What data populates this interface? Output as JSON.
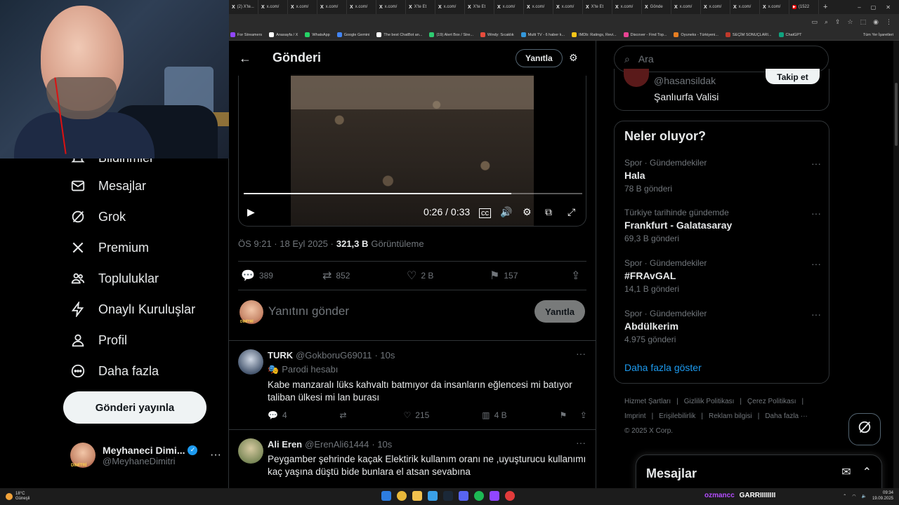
{
  "browser": {
    "tabs": [
      "(2) X'te...",
      "x.com/",
      "x.com/",
      "x.com/",
      "x.com/",
      "x.com/",
      "X'te Et",
      "x.com/",
      "X'te Et",
      "x.com/",
      "x.com/",
      "x.com/",
      "X'te Et",
      "x.com/",
      "Gönde",
      "x.com/",
      "x.com/",
      "x.com/",
      "x.com/",
      "(1522"
    ],
    "bookmarks": [
      "For Streamers",
      "Anasayfa / X",
      "WhatsApp",
      "Google Gemini",
      "The best ChatBot an...",
      "(19) Alert Box / Stre...",
      "Windy: Sıcaklık",
      "Multi TV - 6 haber k...",
      "IMDb: Ratings, Revi...",
      "Discover - Find Top...",
      "Oyuneks - Türkiyeni...",
      "SEÇİM SONUÇLARI...",
      "ChatGPT"
    ],
    "all_bookmarks": "Tüm Yer İşaretleri"
  },
  "sidebar": {
    "items": [
      {
        "label": "Bildirimler",
        "icon": "bell-icon"
      },
      {
        "label": "Mesajlar",
        "icon": "mail-icon"
      },
      {
        "label": "Grok",
        "icon": "grok-icon"
      },
      {
        "label": "Premium",
        "icon": "x-logo-icon"
      },
      {
        "label": "Topluluklar",
        "icon": "people-icon"
      },
      {
        "label": "Onaylı Kuruluşlar",
        "icon": "lightning-icon"
      },
      {
        "label": "Profil",
        "icon": "person-icon"
      },
      {
        "label": "Daha fazla",
        "icon": "more-circle-icon"
      }
    ],
    "post_button": "Gönderi yayınla",
    "account": {
      "name": "Meyhaneci Dimi...",
      "handle": "@MeyhaneDimitri",
      "avatar_text": "DİMİTRİ"
    }
  },
  "main": {
    "title": "Gönderi",
    "reply_pill": "Yanıtla",
    "video": {
      "current": "0:26",
      "duration": "0:33",
      "progress": 0.79
    },
    "meta": {
      "time": "ÖS 9:21 · 18 Eyl 2025 ·",
      "views": "321,3 B",
      "views_label": "Görüntüleme"
    },
    "stats": {
      "replies": "389",
      "reposts": "852",
      "likes": "2 B",
      "bookmarks": "157"
    },
    "compose": {
      "placeholder": "Yanıtını gönder",
      "button": "Yanıtla",
      "avatar_text": "DİMİTRİ"
    },
    "replies": [
      {
        "name": "TURK",
        "handle": "@GokboruG69011",
        "time": "· 10s",
        "parody": "Parodi hesabı",
        "text": "Kabe  manzaralı lüks kahvaltı batmıyor da insanların eğlencesi mi batıyor taliban ülkesi mi lan burası",
        "replies": "4",
        "reposts": "",
        "likes": "215",
        "views": "4 B"
      },
      {
        "name": "Ali Eren",
        "handle": "@ErenAli61444",
        "time": "· 10s",
        "text": "Peygamber şehrinde kaçak Elektirik kullanım oranı ne ,uyuşturucu kullanımı kaç yaşına düştü bide bunlara el atsan sevabına"
      }
    ]
  },
  "right": {
    "search_placeholder": "Ara",
    "follow_card": {
      "handle": "@hasansildak",
      "bio": "Şanlıurfa Valisi",
      "button": "Takip et"
    },
    "trends_title": "Neler oluyor?",
    "trends": [
      {
        "category": "Spor · Gündemdekiler",
        "name": "Hala",
        "count": "78 B gönderi"
      },
      {
        "category": "Türkiye tarihinde gündemde",
        "name": "Frankfurt - Galatasaray",
        "count": "69,3 B gönderi"
      },
      {
        "category": "Spor · Gündemdekiler",
        "name": "#FRAvGAL",
        "count": "14,1 B gönderi"
      },
      {
        "category": "Spor · Gündemdekiler",
        "name": "Abdülkerim",
        "count": "4.975 gönderi"
      }
    ],
    "show_more": "Daha fazla göster",
    "footer": [
      "Hizmet Şartları",
      "|",
      "Gizlilik Politikası",
      "|",
      "Çerez Politikası",
      "|",
      "Imprint",
      "|",
      "Erişilebilirlik",
      "|",
      "Reklam bilgisi",
      "|",
      "Daha fazla ···",
      "© 2025 X Corp."
    ],
    "messages_drawer": "Mesajlar"
  },
  "taskbar": {
    "weather_temp": "18°C",
    "weather_desc": "Güneşli",
    "chat_user": "ozmancc",
    "chat_message": "GARRIIIIIIII",
    "time": "09:34",
    "date": "19.09.2025"
  },
  "colors": {
    "accent": "#1d9bf0",
    "bg": "#000000",
    "border": "#2f3336",
    "muted": "#71767b"
  }
}
